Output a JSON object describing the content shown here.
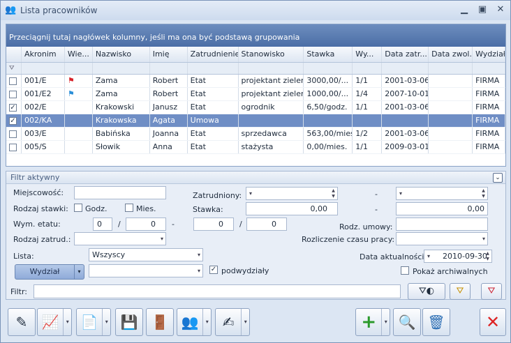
{
  "window": {
    "title": "Lista pracowników"
  },
  "grid": {
    "group_hint": "Przeciągnij tutaj nagłówek kolumny, jeśli ma ona być podstawą grupowania",
    "columns": [
      "",
      "Akronim",
      "Wie...",
      "Nazwisko",
      "Imię",
      "Zatrudnienie",
      "Stanowisko",
      "Stawka",
      "Wy...",
      "Data zatr...",
      "Data zwol.",
      "Wydział"
    ],
    "rows": [
      {
        "checked": false,
        "akronim": "001/E",
        "flag": "red",
        "nazwisko": "Zama",
        "imie": "Robert",
        "zatr": "Etat",
        "stanowisko": "projektant zieleni",
        "stawka": "3000,00/...",
        "wym": "1/1",
        "data_zatr": "2001-03-06",
        "data_zwol": "",
        "wydzial": "FIRMA"
      },
      {
        "checked": false,
        "akronim": "001/E2",
        "flag": "blue",
        "nazwisko": "Zama",
        "imie": "Robert",
        "zatr": "Etat",
        "stanowisko": "projektant zieleni",
        "stawka": "1000,00/...",
        "wym": "1/4",
        "data_zatr": "2007-10-01",
        "data_zwol": "",
        "wydzial": "FIRMA"
      },
      {
        "checked": true,
        "akronim": "002/E",
        "flag": "",
        "nazwisko": "Krakowski",
        "imie": "Janusz",
        "zatr": "Etat",
        "stanowisko": "ogrodnik",
        "stawka": "6,50/godz.",
        "wym": "1/1",
        "data_zatr": "2001-03-06",
        "data_zwol": "",
        "wydzial": "FIRMA"
      },
      {
        "checked": true,
        "akronim": "002/KA",
        "flag": "",
        "nazwisko": "Krakowska",
        "imie": "Agata",
        "zatr": "Umowa",
        "stanowisko": "",
        "stawka": "",
        "wym": "",
        "data_zatr": "",
        "data_zwol": "",
        "wydzial": "FIRMA"
      },
      {
        "checked": false,
        "akronim": "003/E",
        "flag": "",
        "nazwisko": "Babińska",
        "imie": "Joanna",
        "zatr": "Etat",
        "stanowisko": "sprzedawca",
        "stawka": "563,00/mies.",
        "wym": "1/2",
        "data_zatr": "2001-03-06",
        "data_zwol": "",
        "wydzial": "FIRMA"
      },
      {
        "checked": false,
        "akronim": "005/S",
        "flag": "",
        "nazwisko": "Słowik",
        "imie": "Anna",
        "zatr": "Etat",
        "stanowisko": "stażysta",
        "stawka": "0,00/mies.",
        "wym": "1/1",
        "data_zatr": "2009-03-01",
        "data_zwol": "",
        "wydzial": "FIRMA"
      }
    ],
    "selected_index": 3
  },
  "filter": {
    "header": "Filtr aktywny",
    "miejscowosc_label": "Miejscowość:",
    "miejscowosc_value": "",
    "zatrudniony_label": "Zatrudniony:",
    "rodzaj_stawki_label": "Rodzaj stawki:",
    "godz_label": "Godz.",
    "mies_label": "Mies.",
    "stawka_label": "Stawka:",
    "stawka_from": "0,00",
    "stawka_to": "0,00",
    "wym_etatu_label": "Wym. etatu:",
    "wym_a": "0",
    "wym_b": "0",
    "wym_c": "0",
    "wym_d": "0",
    "slash": "/",
    "dash": "-",
    "rodz_umowy_label": "Rodz. umowy:",
    "rodzaj_zatrud_label": "Rodzaj zatrud.:",
    "rozliczenie_label": "Rozliczenie czasu pracy:",
    "lista_label": "Lista:",
    "lista_value": "Wszyscy",
    "data_akt_label": "Data aktualności:",
    "data_akt_value": "2010-09-30",
    "wydzial_button": "Wydział",
    "podwydzialy_label": "podwydziały",
    "pokaz_arch_label": "Pokaż archiwalnych",
    "filtr_label": "Filtr:",
    "filtr_value": ""
  }
}
